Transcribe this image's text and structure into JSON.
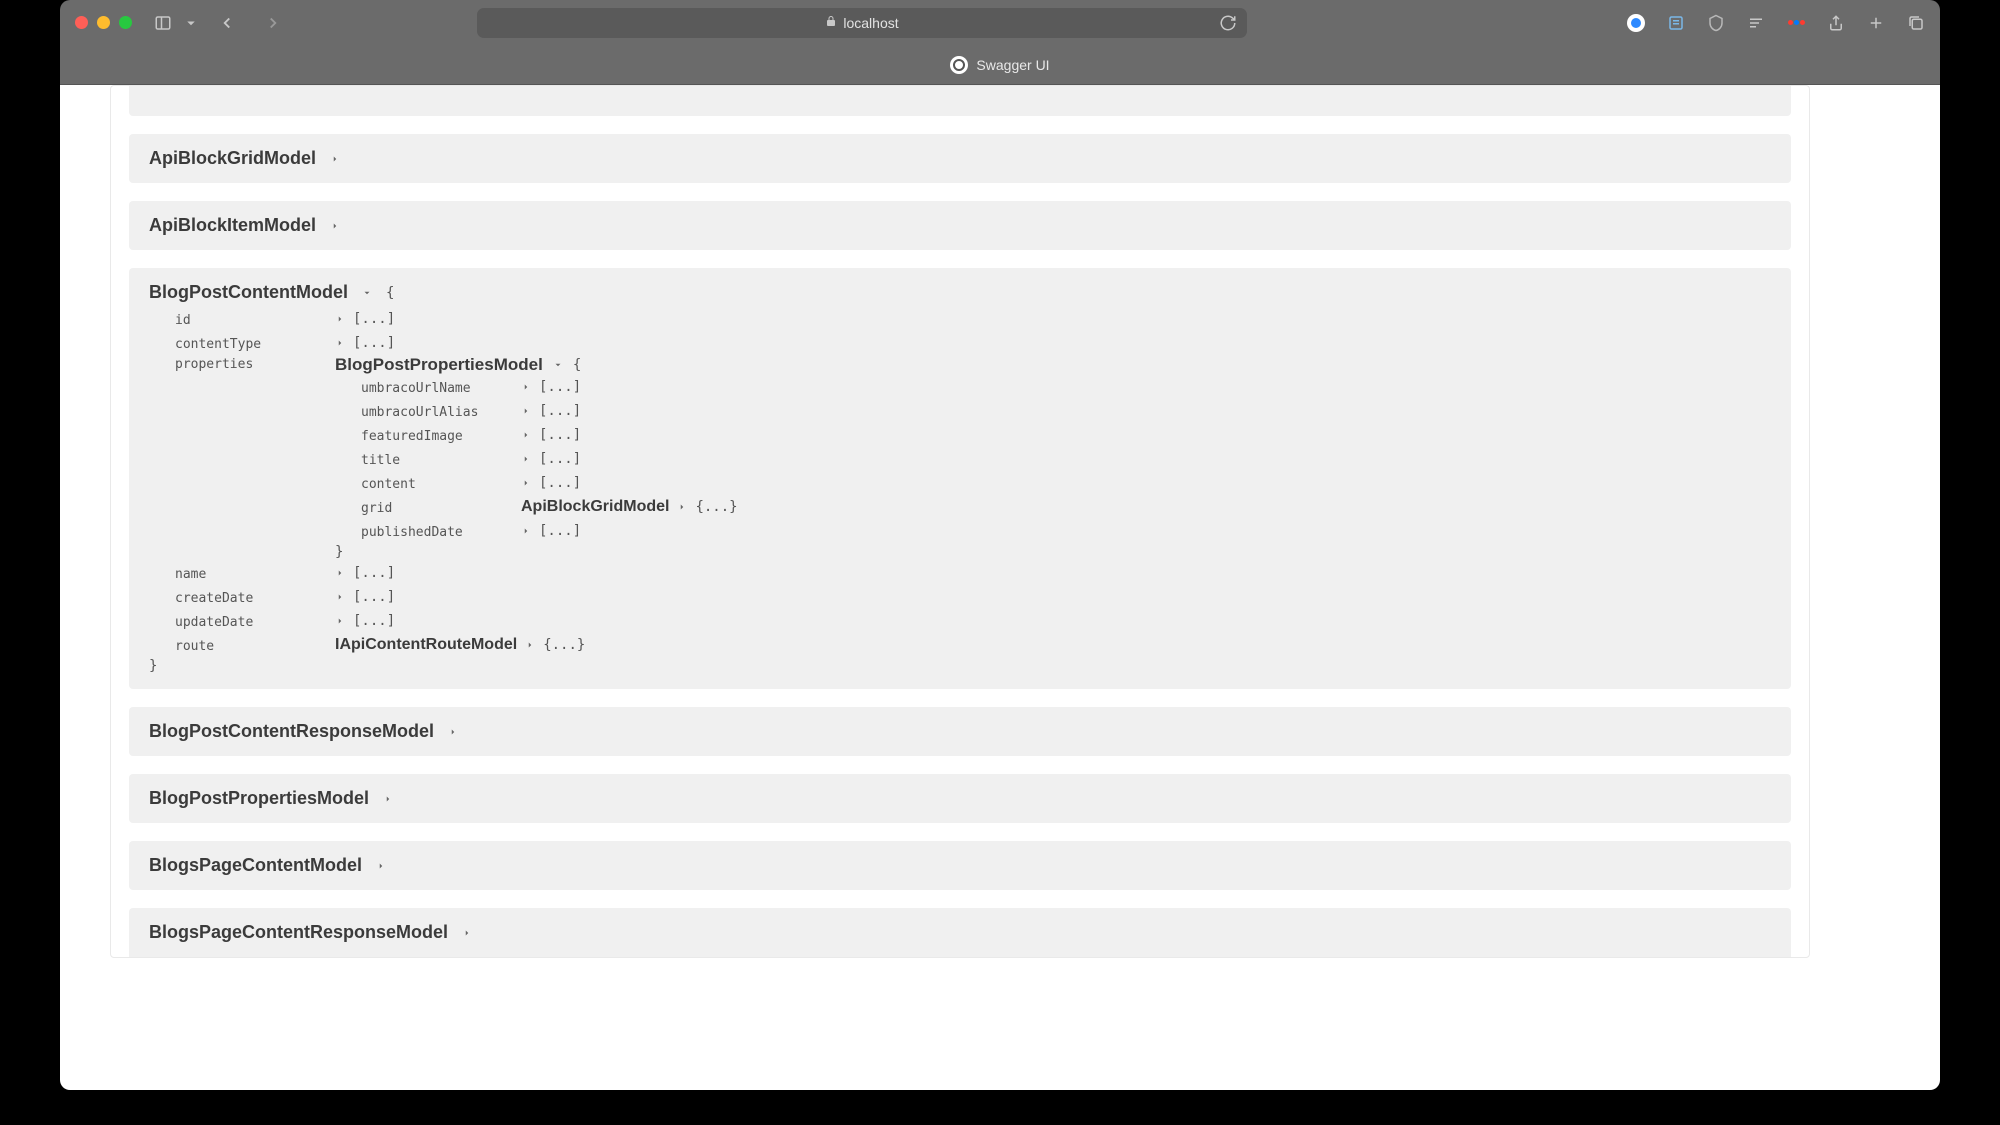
{
  "browser": {
    "url": "localhost",
    "tab_title": "Swagger UI"
  },
  "models": {
    "truncated_top": {
      "name": ""
    },
    "api_block_grid": {
      "name": "ApiBlockGridModel"
    },
    "api_block_item": {
      "name": "ApiBlockItemModel"
    },
    "blog_post_content": {
      "name": "BlogPostContentModel",
      "props": {
        "id": "id",
        "contentType": "contentType",
        "properties": "properties",
        "name": "name",
        "createDate": "createDate",
        "updateDate": "updateDate",
        "route": "route"
      },
      "nested_properties": {
        "name": "BlogPostPropertiesModel",
        "props": {
          "umbracoUrlName": "umbracoUrlName",
          "umbracoUrlAlias": "umbracoUrlAlias",
          "featuredImage": "featuredImage",
          "title": "title",
          "content": "content",
          "grid": "grid",
          "publishedDate": "publishedDate"
        },
        "grid_model": "ApiBlockGridModel"
      },
      "route_model": "IApiContentRouteModel"
    },
    "blog_post_content_response": {
      "name": "BlogPostContentResponseModel"
    },
    "blog_post_properties": {
      "name": "BlogPostPropertiesModel"
    },
    "blogs_page_content": {
      "name": "BlogsPageContentModel"
    },
    "blogs_page_content_response": {
      "name": "BlogsPageContentResponseModel"
    },
    "collapsed_placeholder": "[...]",
    "collapsed_braces": "{...}"
  }
}
